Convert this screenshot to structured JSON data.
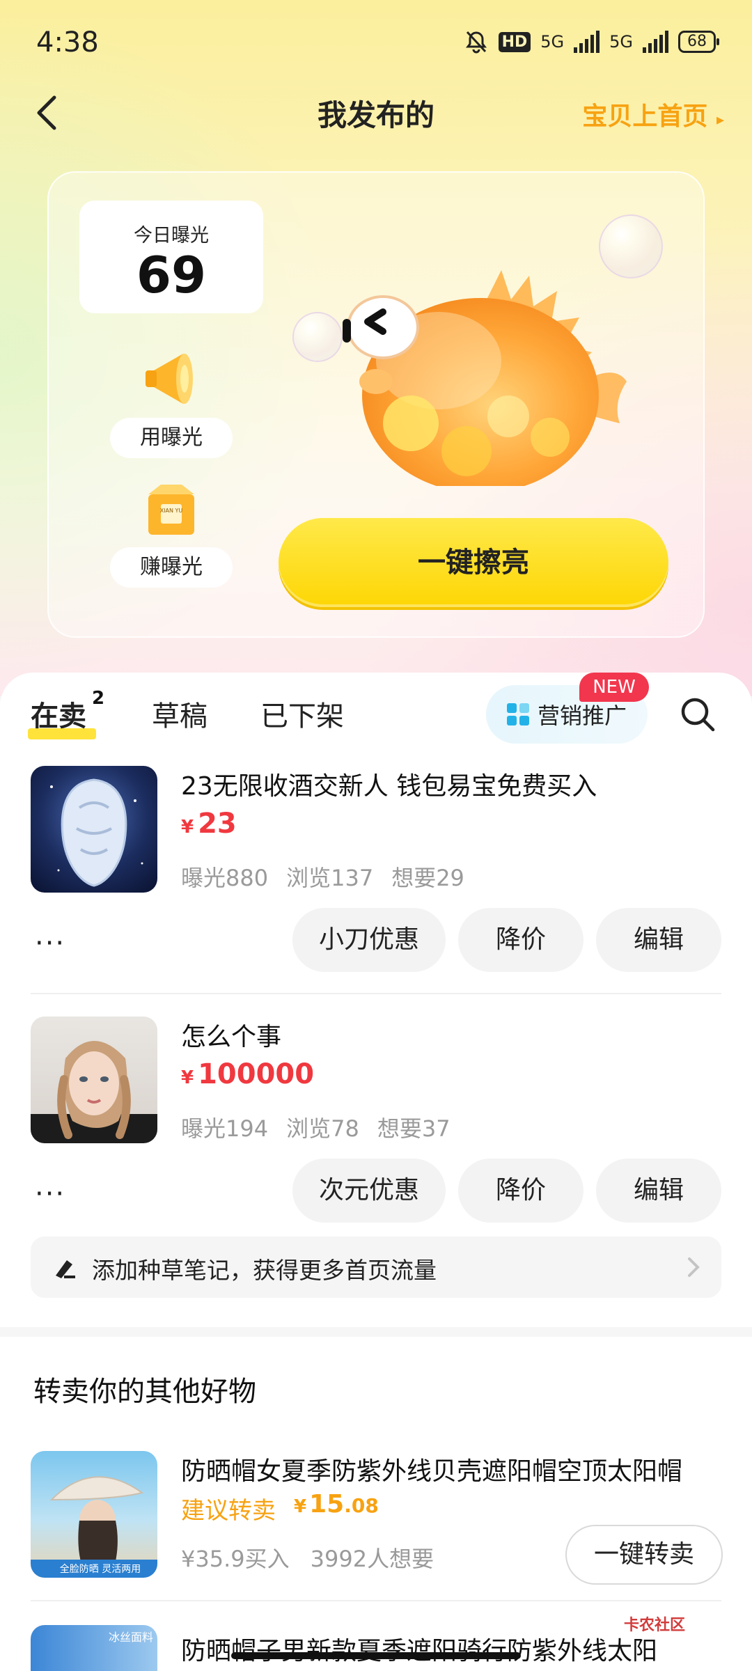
{
  "status_bar": {
    "time": "4:38",
    "hd": "HD",
    "net1": "5G",
    "net2": "5G",
    "battery": "68"
  },
  "nav": {
    "title": "我发布的",
    "right_link": "宝贝上首页"
  },
  "hero": {
    "exposure_label": "今日曝光",
    "exposure_value": "69",
    "use_exposure": "用曝光",
    "earn_exposure": "赚曝光",
    "box_text": "XIAN YU",
    "shine_button": "一键擦亮"
  },
  "tabs": {
    "selling": "在卖",
    "selling_count": "2",
    "drafts": "草稿",
    "removed": "已下架",
    "promo": "营销推广",
    "new_badge": "NEW"
  },
  "listings": [
    {
      "title": "23无限收酒交新人 钱包易宝免费买入",
      "currency": "¥",
      "price": "23",
      "stats": {
        "exposure": "曝光880",
        "views": "浏览137",
        "wants": "想要29"
      },
      "more": "···",
      "actions": [
        "小刀优惠",
        "降价",
        "编辑"
      ]
    },
    {
      "title": "怎么个事",
      "currency": "¥",
      "price": "100000",
      "stats": {
        "exposure": "曝光194",
        "views": "浏览78",
        "wants": "想要37"
      },
      "more": "···",
      "actions": [
        "次元优惠",
        "降价",
        "编辑"
      ]
    }
  ],
  "note_bar": {
    "text": "添加种草笔记，获得更多首页流量"
  },
  "resell": {
    "title": "转卖你的其他好物",
    "item": {
      "title": "防晒帽女夏季防紫外线贝壳遮阳帽空顶太阳帽",
      "suggest_label": "建议转卖",
      "currency": "¥",
      "price_int": "15",
      "price_dec": ".08",
      "bought": "¥35.9买入",
      "wants": "3992人想要",
      "button": "一键转卖",
      "thumb_text": "全脸防晒 灵活两用"
    },
    "next_item": {
      "title": "防晒帽子男新款夏季遮阳骑行防紫外线太阳",
      "thumb_tag": "冰丝面料"
    }
  },
  "watermark": "卡农社区",
  "colors": {
    "accent_yellow": "#FDD604",
    "price_red": "#F0383F",
    "orange": "#F7A212",
    "badge_red": "#F2364E"
  }
}
